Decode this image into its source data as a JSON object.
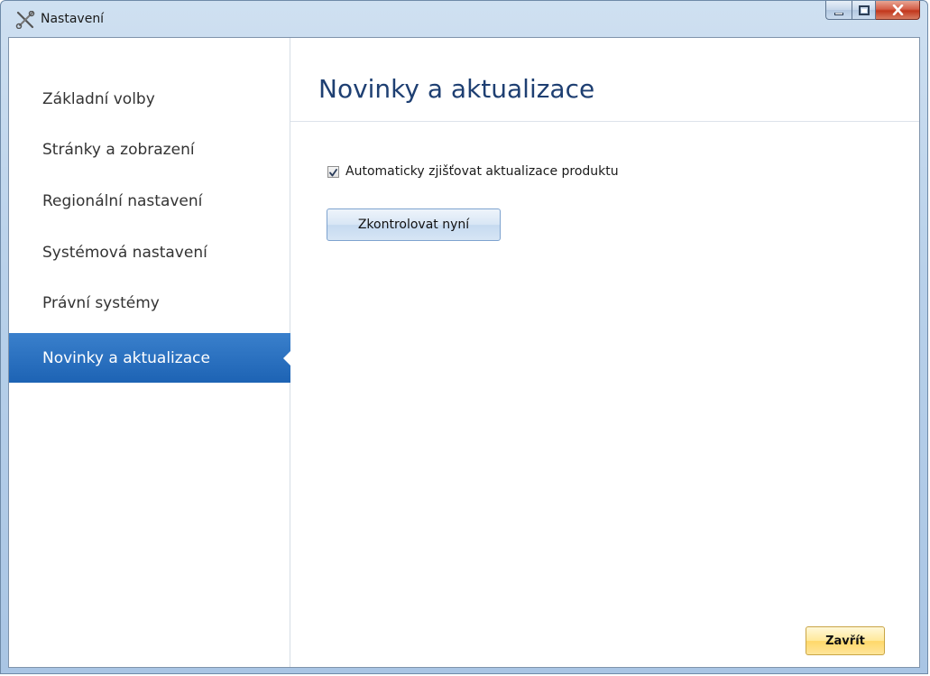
{
  "window": {
    "title": "Nastavení"
  },
  "sidebar": {
    "items": [
      {
        "label": "Základní volby",
        "active": false
      },
      {
        "label": "Stránky a zobrazení",
        "active": false
      },
      {
        "label": "Regionální nastavení",
        "active": false
      },
      {
        "label": "Systémová nastavení",
        "active": false
      },
      {
        "label": "Právní systémy",
        "active": false
      },
      {
        "label": "Novinky a aktualizace",
        "active": true
      }
    ]
  },
  "content": {
    "title": "Novinky a aktualizace",
    "auto_check": {
      "label": "Automaticky zjišťovat aktualizace produktu",
      "checked": true
    },
    "check_now_label": "Zkontrolovat nyní"
  },
  "footer": {
    "close_label": "Zavřít"
  },
  "icons": {
    "app": "tools-icon",
    "minimize": "minimize-icon",
    "maximize": "maximize-icon",
    "close": "close-icon",
    "check": "checkmark-icon"
  },
  "colors": {
    "active_nav": "#1d63b4",
    "title_text": "#1e3f72",
    "close_button": "#c2371c",
    "primary_button": "#ffd86a"
  }
}
